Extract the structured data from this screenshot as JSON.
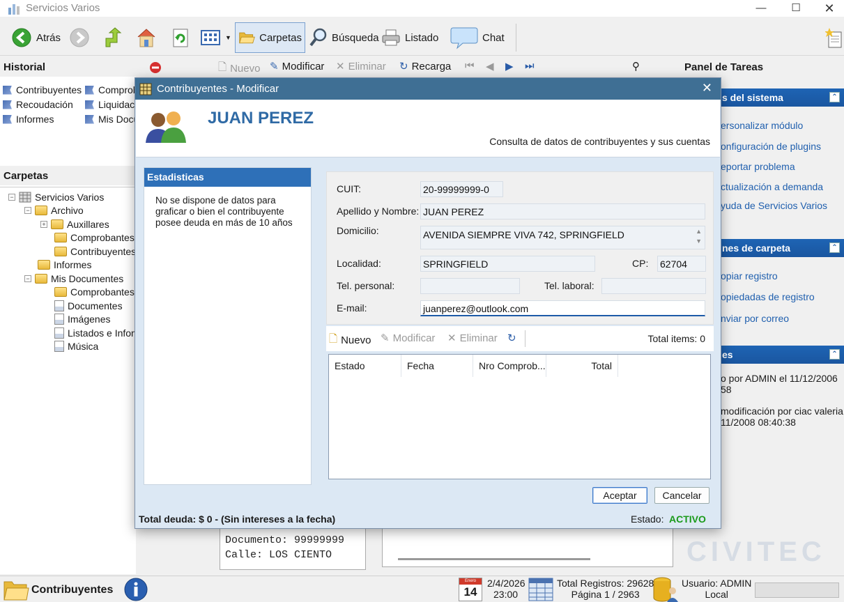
{
  "app": {
    "title": "Servicios Varios"
  },
  "toolbar": {
    "back": "Atrás",
    "folders": "Carpetas",
    "search": "Búsqueda",
    "list": "Listado",
    "chat": "Chat"
  },
  "history": {
    "title": "Historial",
    "items": [
      "Contribuyentes",
      "Comprob",
      "Recoudación",
      "Liquidaci",
      "Informes",
      "Mis Docu"
    ]
  },
  "folders": {
    "title": "Carpetas",
    "tree": [
      "Servicios Varios",
      "Archivo",
      "Auxillares",
      "Comprobantes",
      "Contribuyentes",
      "Informes",
      "Mis Documentes",
      "Comprobantes d",
      "Documentes",
      "Imágenes",
      "Listados e Infon",
      "Música"
    ]
  },
  "record_toolbar": {
    "new": "Nuevo",
    "modify": "Modificar",
    "delete": "Eliminar",
    "reload": "Recarga"
  },
  "background_record": {
    "line1": "Documento: 99999999",
    "line2": "Calle: LOS CIENTO"
  },
  "tasks": {
    "title": "Panel de Tareas",
    "system_section": "s del sistema",
    "system_links": [
      "ersonalizar módulo",
      "onfiguración de plugins",
      "eportar problema",
      "ctualización a demanda",
      "yuda de Servicios Varios"
    ],
    "folder_section": "nes de carpeta",
    "folder_links": [
      "opiar registro",
      "opiedadas de registro",
      "nviar por correo"
    ],
    "info_section": "es",
    "info_lines": [
      "o por ADMIN el 11/12/2006",
      "58",
      "modificación por ciac valeria",
      "11/2008 08:40:38"
    ]
  },
  "statusbar": {
    "module": "Contribuyentes",
    "cal_month": "Enero",
    "cal_day": "14",
    "date": "2/4/2026",
    "time": "23:00",
    "total_records": "Total Registros: 29628",
    "page": "Página 1 / 2963",
    "user": "Usuario: ADMIN",
    "mode": "Local"
  },
  "brand": "CIVITEC",
  "dialog": {
    "title": "Contribuyentes - Modificar",
    "name": "JUAN PEREZ",
    "subtitle": "Consulta de datos de contribuyentes y sus cuentas",
    "stats_title": "Estadisticas",
    "stats_text": "No se dispone de datos para graficar o bien el contribuyente posee deuda en más de 10 años",
    "form": {
      "cuit_label": "CUIT:",
      "cuit": "20-99999999-0",
      "name_label": "Apellido y Nombre:",
      "name": "JUAN PEREZ",
      "address_label": "Domicilio:",
      "address": "AVENIDA SIEMPRE VIVA 742, SPRINGFIELD",
      "city_label": "Localidad:",
      "city": "SPRINGFIELD",
      "zip_label": "CP:",
      "zip": "62704",
      "phone_label": "Tel. personal:",
      "phone": "",
      "work_phone_label": "Tel. laboral:",
      "work_phone": "",
      "email_label": "E-mail:",
      "email": "juanperez@outlook.com"
    },
    "grid_toolbar": {
      "new": "Nuevo",
      "modify": "Modificar",
      "delete": "Eliminar",
      "total": "Total items: 0"
    },
    "grid_columns": [
      "Estado",
      "Fecha",
      "Nro Comprob...",
      "Total"
    ],
    "accept": "Aceptar",
    "cancel": "Cancelar",
    "debt": "Total deuda: $ 0 - (Sin intereses a la fecha)",
    "status_label": "Estado:",
    "status_value": "ACTIVO"
  },
  "colors": {
    "accent": "#2e70b8",
    "status_ok": "#1a9a1a",
    "title_bar": "#3f6f94"
  }
}
